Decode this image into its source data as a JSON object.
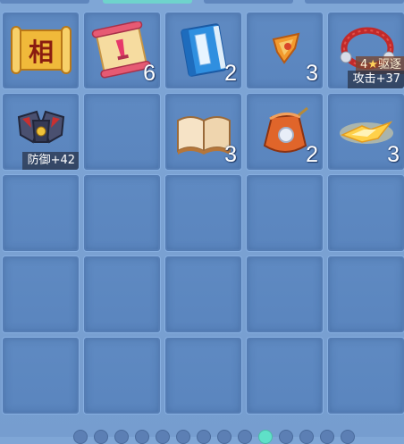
{
  "tabs": [
    "",
    "",
    "",
    ""
  ],
  "inventory": {
    "slots": [
      {
        "icon": "seal-scroll-icon",
        "glyph": "相",
        "count": ""
      },
      {
        "icon": "painting-scroll-icon",
        "count": "6"
      },
      {
        "icon": "blue-book-icon",
        "count": "2"
      },
      {
        "icon": "fragment-icon",
        "count": "3"
      },
      {
        "icon": "bracelet-icon",
        "badge_level": "4",
        "badge_star": "★",
        "badge_name": "驱逐",
        "stat": "攻击+37"
      },
      {
        "icon": "armor-icon",
        "stat": "防御+42"
      },
      {
        "icon": "open-book-icon",
        "count": "3"
      },
      {
        "icon": "pouch-icon",
        "count": "2"
      },
      {
        "icon": "glowing-shard-icon",
        "count": "3"
      }
    ]
  },
  "pager": {
    "total": 14,
    "active_index": 9
  }
}
